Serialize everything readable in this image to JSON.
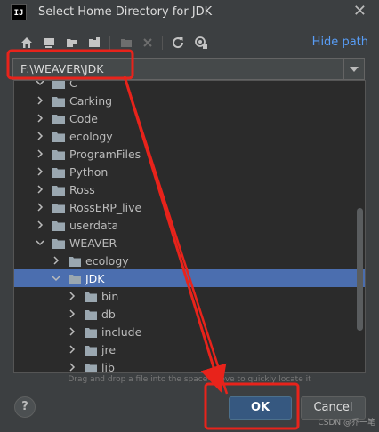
{
  "window": {
    "title": "Select Home Directory for JDK",
    "logo_text": "IJ",
    "close_label": "✕"
  },
  "toolbar": {
    "icons": [
      "home-icon",
      "desktop-icon",
      "project-folder-icon",
      "module-folder-icon",
      "new-folder-icon",
      "delete-icon",
      "refresh-icon",
      "show-hidden-icon"
    ],
    "hide_path_label": "Hide path"
  },
  "path_field": {
    "value": "F:\\WEAVER\\JDK"
  },
  "tree": {
    "rows": [
      {
        "label": "C",
        "expanded": true
      },
      {
        "label": "Carking"
      },
      {
        "label": "Code"
      },
      {
        "label": "ecology"
      },
      {
        "label": "ProgramFiles"
      },
      {
        "label": "Python"
      },
      {
        "label": "Ross"
      },
      {
        "label": "RossERP_live"
      },
      {
        "label": "userdata"
      },
      {
        "label": "WEAVER",
        "expanded": true
      },
      {
        "label": "ecology"
      },
      {
        "label": "JDK",
        "expanded": true,
        "selected": true
      },
      {
        "label": "bin"
      },
      {
        "label": "db"
      },
      {
        "label": "include"
      },
      {
        "label": "jre"
      },
      {
        "label": "lib"
      }
    ]
  },
  "hint": "Drag and drop a file into the space above to quickly locate it",
  "buttons": {
    "help": "?",
    "ok": "OK",
    "cancel": "Cancel"
  },
  "watermark": "CSDN @乔一笔",
  "colors": {
    "selection": "#4b6eaf",
    "link": "#589df6",
    "annotation": "#e8231b",
    "ok_button": "#365880"
  }
}
